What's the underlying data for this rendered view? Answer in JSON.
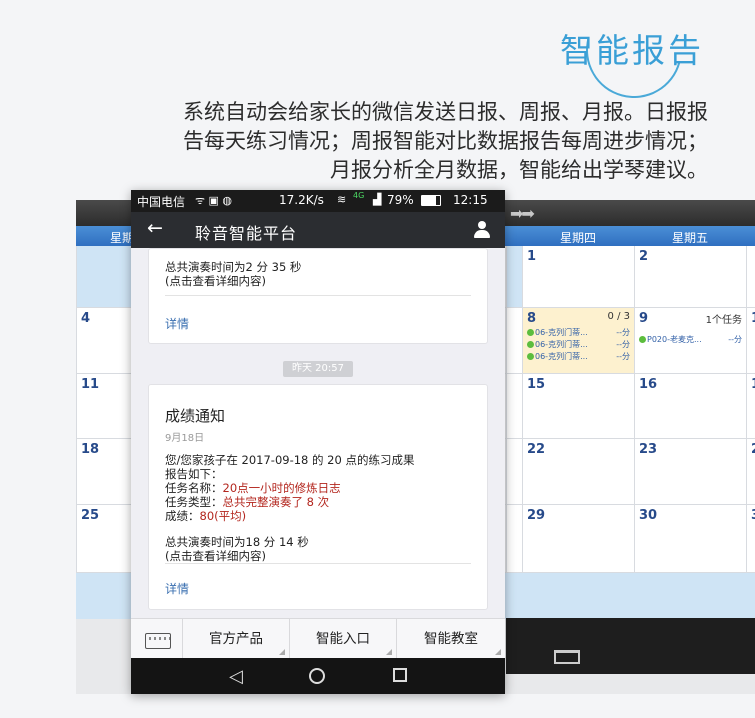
{
  "header": {
    "title": "智能报告",
    "description": [
      "系统自动会给家长的微信发送日报、周报、月报。日报报",
      "告每天练习情况；周报智能对比数据报告每周进步情况；",
      "月报分析全月数据，智能给出学琴建议。"
    ]
  },
  "calendar": {
    "weekdays": {
      "left": "星期",
      "thu": "星期四",
      "fri": "星期五"
    },
    "rows": [
      {
        "c1": "",
        "c4": "1",
        "c5": "2",
        "c6": ""
      },
      {
        "c1": "4",
        "c4": "8",
        "c5": "9",
        "c6": "1"
      },
      {
        "c1": "11",
        "c4": "15",
        "c5": "16",
        "c6": "1"
      },
      {
        "c1": "18",
        "c4": "22",
        "c5": "23",
        "c6": "2"
      },
      {
        "c1": "25",
        "c4": "29",
        "c5": "30",
        "c6": "3"
      }
    ],
    "day8": {
      "count": "0 / 3",
      "events": [
        "06-克列门蒂...",
        "06-克列门蒂...",
        "06-克列门蒂..."
      ],
      "suffix": [
        "--分",
        "--分",
        "--分"
      ]
    },
    "day9": {
      "count": "1个任务",
      "events": [
        "P020-老麦克..."
      ],
      "suffix": [
        "--分"
      ]
    },
    "partial_right": [
      "--",
      "--"
    ]
  },
  "phone": {
    "status": {
      "carrier": "中国电信",
      "speed": "17.2K/s",
      "battery": "79%",
      "time": "12:15",
      "net": "4G"
    },
    "appbar": {
      "title": "聆音智能平台"
    },
    "card1": {
      "lines": [
        "总共演奏时间为2 分 35 秒",
        "(点击查看详细内容)"
      ],
      "detail": "详情"
    },
    "timestamp": "昨天 20:57",
    "card2": {
      "title": "成绩通知",
      "date": "9月18日",
      "intro": [
        "您/您家孩子在 2017-09-18 的 20 点的练习成果",
        "报告如下："
      ],
      "task_name_label": "任务名称：",
      "task_name": "20点一小时的修炼日志",
      "task_type_label": "任务类型：",
      "task_type": "总共完整演奏了 8 次",
      "score_label": "成绩：",
      "score": "80(平均)",
      "total": "总共演奏时间为18 分 14 秒",
      "hint": "(点击查看详细内容)",
      "detail": "详情"
    },
    "menu": [
      "官方产品",
      "智能入口",
      "智能教室"
    ]
  }
}
